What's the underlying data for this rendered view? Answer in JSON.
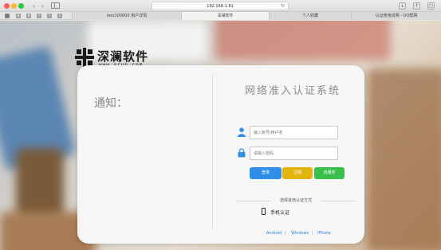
{
  "browser": {
    "url": "192.168.1.81",
    "tabs": [
      {
        "label": "test100000 用户详情",
        "active": false
      },
      {
        "label": "深澜软件",
        "active": true
      },
      {
        "label": "个人收藏",
        "active": false
      },
      {
        "label": "认证使用说明 - OQ帮网",
        "active": false
      }
    ],
    "bookmark_icons": [
      "B",
      "B",
      "T",
      "T",
      "C"
    ]
  },
  "logo": {
    "name": "深澜软件",
    "sub": "www.srun.com"
  },
  "card": {
    "notice_label": "通知：",
    "title": "网络准入认证系统",
    "username_placeholder": "输入账号/用户名",
    "password_placeholder": "请输入密码",
    "login_button": "登录",
    "logout_button": "注销",
    "self_service_button": "自服务",
    "other_methods_label": "选择其他认证方式",
    "phone_auth_label": "手机认证",
    "footer_links": [
      "Android",
      "Windows",
      "iPhone"
    ]
  },
  "colors": {
    "login": "#2f8fe8",
    "logout": "#e2b40e",
    "self_service": "#3bbf4b",
    "link": "#2f7ed8",
    "user_icon": "#2f8fe8",
    "lock_icon": "#2f8fe8"
  }
}
